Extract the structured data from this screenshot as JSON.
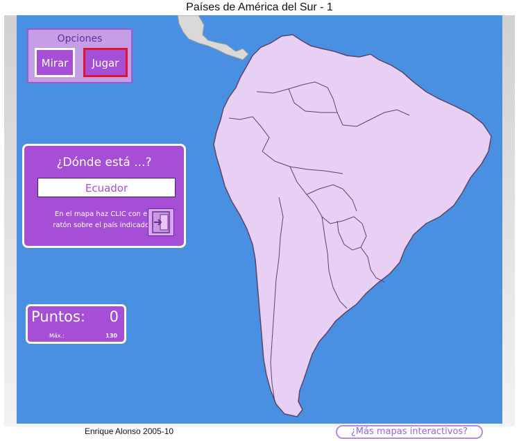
{
  "window": {
    "title": "Países de América del Sur - 1"
  },
  "options": {
    "title": "Opciones",
    "buttons": [
      {
        "label": "Mirar"
      },
      {
        "label": "Jugar"
      }
    ]
  },
  "question": {
    "title": "¿Dónde está ...?",
    "country": "Ecuador",
    "instruction_line1": "En el mapa haz CLIC con el",
    "instruction_line2": "ratón sobre el país indicado"
  },
  "score": {
    "label": "Puntos:",
    "value": "0",
    "max_label": "Máx.:",
    "max_value": "130"
  },
  "footer": {
    "author": "Enrique Alonso 2005-10",
    "more_maps": "¿Más mapas interactivos?"
  },
  "colors": {
    "ocean": "#4a90e2",
    "land": "#e8d0f4",
    "panel": "#a64fd6",
    "active_border": "#e0142d"
  }
}
